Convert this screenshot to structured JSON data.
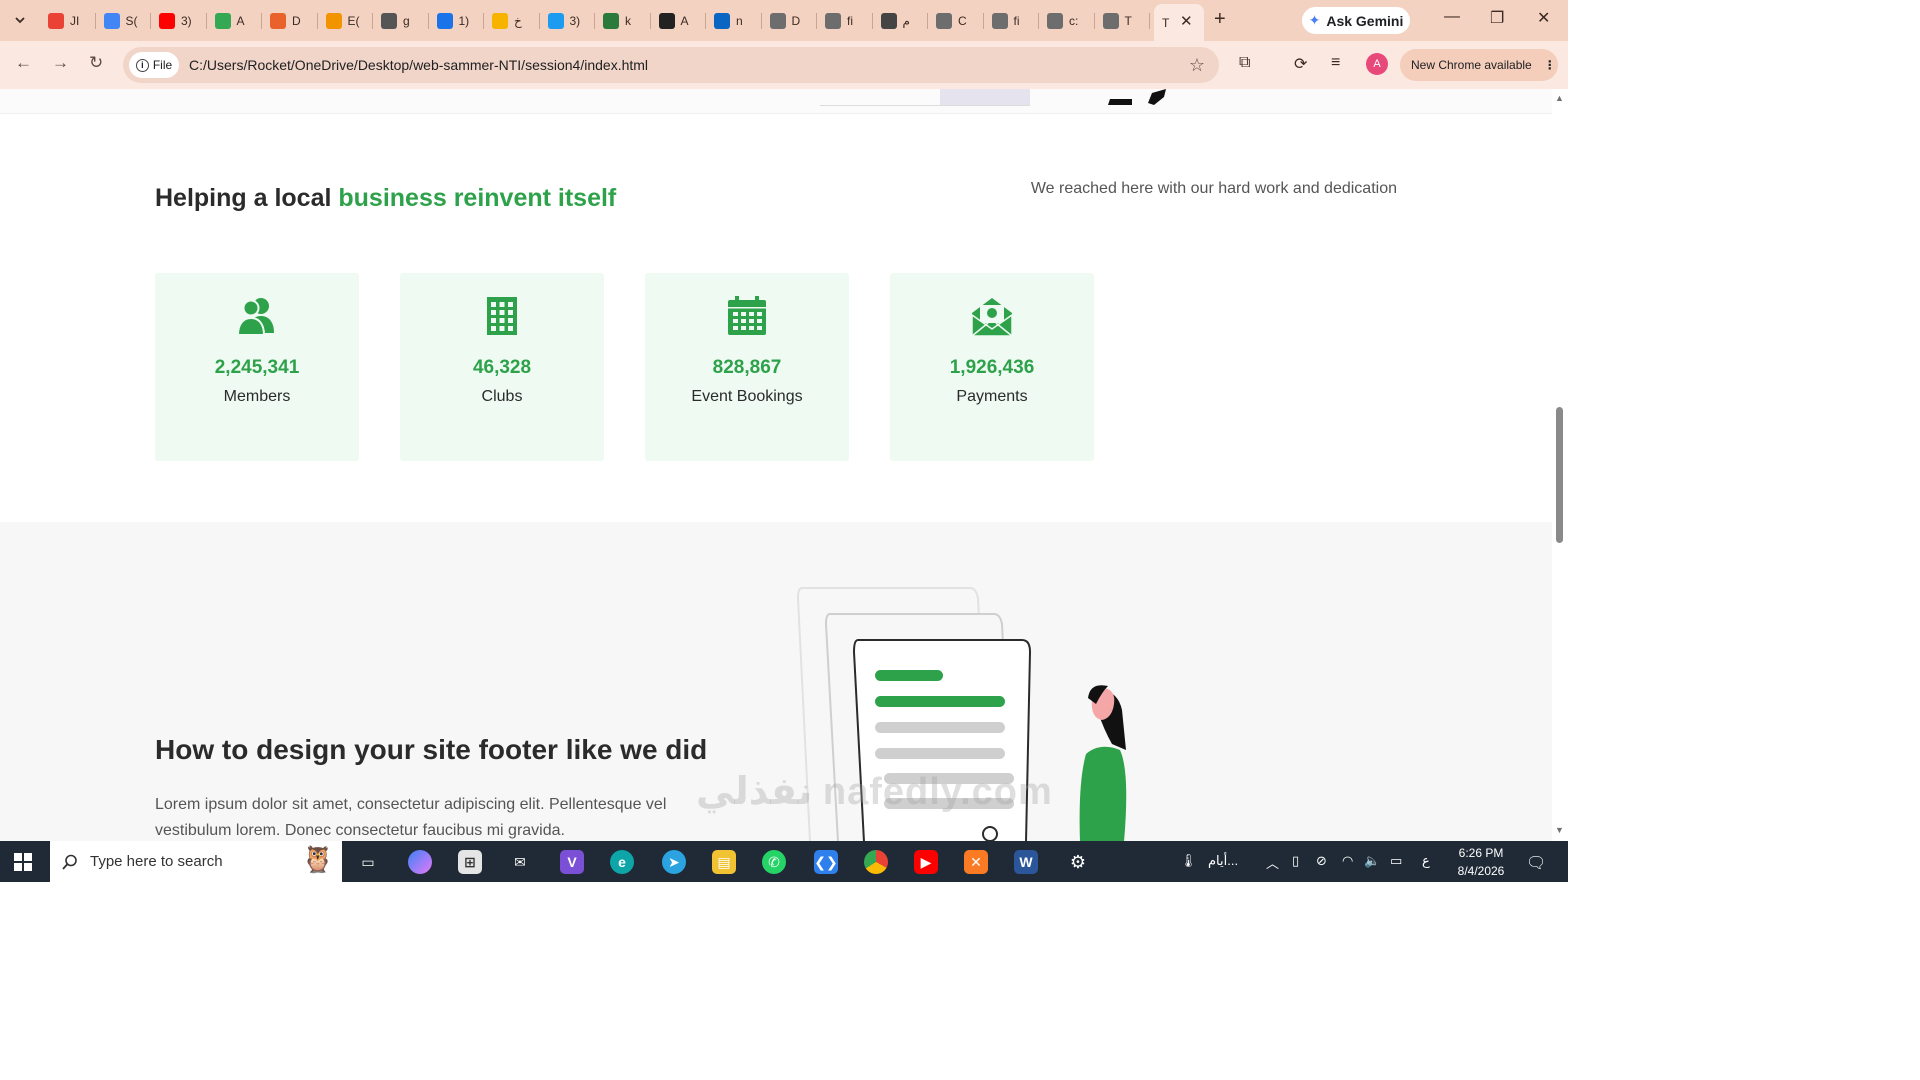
{
  "browser": {
    "tabs": [
      {
        "label": "JI",
        "color": "#ea4335"
      },
      {
        "label": "S(",
        "color": "#4285f4"
      },
      {
        "label": "3)",
        "color": "#ff0000"
      },
      {
        "label": "A",
        "color": "#34a853"
      },
      {
        "label": "D",
        "color": "#e9622b"
      },
      {
        "label": "E(",
        "color": "#f29400"
      },
      {
        "label": "g",
        "color": "#555555"
      },
      {
        "label": "1)",
        "color": "#1a73e8"
      },
      {
        "label": "خ",
        "color": "#f6b400"
      },
      {
        "label": "3)",
        "color": "#1d9bf0"
      },
      {
        "label": "k",
        "color": "#2b7a3b"
      },
      {
        "label": "A",
        "color": "#222222"
      },
      {
        "label": "n",
        "color": "#0a66c2"
      },
      {
        "label": "D",
        "color": "#6d6d6d"
      },
      {
        "label": "fi",
        "color": "#6d6d6d"
      },
      {
        "label": "م",
        "color": "#444444"
      },
      {
        "label": "C",
        "color": "#6d6d6d"
      },
      {
        "label": "fi",
        "color": "#6d6d6d"
      },
      {
        "label": "c:",
        "color": "#6d6d6d"
      },
      {
        "label": "T",
        "color": "#6d6d6d"
      }
    ],
    "active_tab": {
      "label": "T"
    },
    "ask_gemini": "Ask Gemini",
    "scheme_chip": "File",
    "url": "C:/Users/Rocket/OneDrive/Desktop/web-sammer-NTI/session4/index.html",
    "avatar_letter": "A",
    "update_label": "New Chrome available"
  },
  "stats": {
    "title_prefix": "Helping a local ",
    "title_accent": "business reinvent itself",
    "subtitle": "We reached here with our hard work and dedication",
    "cards": [
      {
        "value": "2,245,341",
        "label": "Members",
        "icon": "members-icon"
      },
      {
        "value": "46,328",
        "label": "Clubs",
        "icon": "clubs-icon"
      },
      {
        "value": "828,867",
        "label": "Event Bookings",
        "icon": "calendar-icon"
      },
      {
        "value": "1,926,436",
        "label": "Payments",
        "icon": "payments-icon"
      }
    ],
    "accent_color": "#2ea24a"
  },
  "footer_section": {
    "title": "How to design your site footer like we did",
    "description": "Lorem ipsum dolor sit amet, consectetur adipiscing elit. Pellentesque vel vestibulum lorem. Donec consectetur faucibus mi gravida."
  },
  "watermark": "نفذلي nafedly.com",
  "taskbar": {
    "search_placeholder": "Type here to search",
    "tray_text": "أيام...",
    "lang": "ع",
    "time": "6:26 PM",
    "date": "8/4/2026"
  }
}
